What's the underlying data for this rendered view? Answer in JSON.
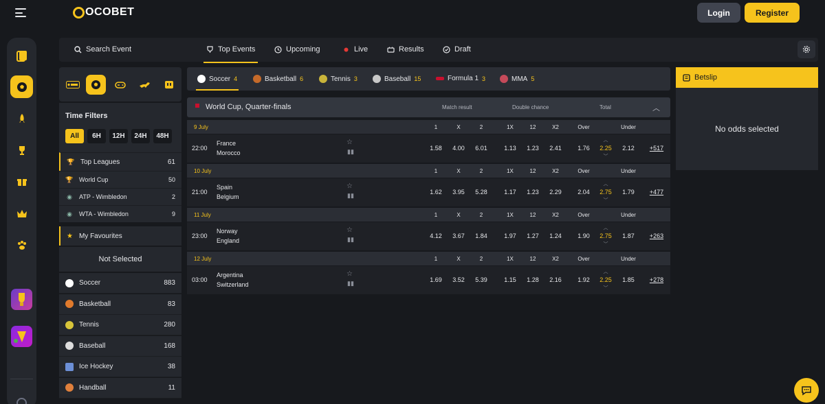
{
  "header": {
    "logo_text": "OCOBET",
    "login_label": "Login",
    "register_label": "Register"
  },
  "colors": {
    "accent": "#f6c31c",
    "background": "#17191d",
    "panel": "#25282e"
  },
  "rail": {
    "items": [
      {
        "icon": "casino-card-icon"
      },
      {
        "icon": "soccer-ball-icon",
        "active": true
      },
      {
        "icon": "rocket-icon"
      },
      {
        "icon": "trophy-icon"
      },
      {
        "icon": "gift-icon"
      },
      {
        "icon": "crown-icon"
      },
      {
        "icon": "paw-icon"
      }
    ]
  },
  "nav": {
    "search_label": "Search Event",
    "tabs": [
      {
        "label": "Top Events",
        "icon": "trophy-icon",
        "active": true
      },
      {
        "label": "Upcoming",
        "icon": "clock-icon"
      },
      {
        "label": "Live",
        "icon": "live-dot-icon"
      },
      {
        "label": "Results",
        "icon": "scoreboard-icon"
      },
      {
        "label": "Draft",
        "icon": "draft-icon"
      }
    ]
  },
  "sidebar": {
    "time_filters_title": "Time Filters",
    "time_filters": [
      "All",
      "6H",
      "12H",
      "24H",
      "48H"
    ],
    "top_leagues": {
      "label": "Top Leagues",
      "count": "61"
    },
    "leagues": [
      {
        "label": "World Cup",
        "count": "50"
      },
      {
        "label": "ATP - Wimbledon",
        "count": "2"
      },
      {
        "label": "WTA - Wimbledon",
        "count": "9"
      }
    ],
    "favourites_label": "My Favourites",
    "not_selected_label": "Not Selected",
    "sports": [
      {
        "label": "Soccer",
        "count": "883",
        "color": "#ffffff"
      },
      {
        "label": "Basketball",
        "count": "83",
        "color": "#e07a2c"
      },
      {
        "label": "Tennis",
        "count": "280",
        "color": "#d7c43a"
      },
      {
        "label": "Baseball",
        "count": "168",
        "color": "#dddddd"
      },
      {
        "label": "Ice Hockey",
        "count": "38",
        "color": "#6c8fd6"
      },
      {
        "label": "Handball",
        "count": "11",
        "color": "#e0803c"
      }
    ]
  },
  "sport_tabs": [
    {
      "label": "Soccer",
      "count": "4",
      "color": "#ffffff",
      "active": true
    },
    {
      "label": "Basketball",
      "count": "6",
      "color": "#c56a2a"
    },
    {
      "label": "Tennis",
      "count": "3",
      "color": "#c9b43a"
    },
    {
      "label": "Baseball",
      "count": "15",
      "color": "#c8c8c8"
    },
    {
      "label": "Formula 1",
      "count": "3",
      "color": "#c8102e"
    },
    {
      "label": "MMA",
      "count": "5",
      "color": "#c54a5a"
    }
  ],
  "competition": {
    "name": "World Cup, Quarter-finals",
    "col_match_result": "Match result",
    "col_double_chance": "Double chance",
    "col_total": "Total"
  },
  "odds_headers": [
    "1",
    "X",
    "2",
    "1X",
    "12",
    "X2",
    "Over",
    "Under"
  ],
  "days": [
    {
      "date": "9 July",
      "match": {
        "time": "22:00",
        "home": "France",
        "away": "Morocco",
        "odds": [
          "1.58",
          "4.00",
          "6.01",
          "1.13",
          "1.23",
          "2.41",
          "1.76",
          "2.25",
          "2.12"
        ],
        "more": "+517"
      }
    },
    {
      "date": "10 July",
      "match": {
        "time": "21:00",
        "home": "Spain",
        "away": "Belgium",
        "odds": [
          "1.62",
          "3.95",
          "5.28",
          "1.17",
          "1.23",
          "2.29",
          "2.04",
          "2.75",
          "1.79"
        ],
        "more": "+477"
      }
    },
    {
      "date": "11 July",
      "match": {
        "time": "23:00",
        "home": "Norway",
        "away": "England",
        "odds": [
          "4.12",
          "3.67",
          "1.84",
          "1.97",
          "1.27",
          "1.24",
          "1.90",
          "2.75",
          "1.87"
        ],
        "more": "+263"
      }
    },
    {
      "date": "12 July",
      "match": {
        "time": "03:00",
        "home": "Argentina",
        "away": "Switzerland",
        "odds": [
          "1.69",
          "3.52",
          "5.39",
          "1.15",
          "1.28",
          "2.16",
          "1.92",
          "2.25",
          "1.85"
        ],
        "more": "+278"
      }
    }
  ],
  "betslip": {
    "title": "Betslip",
    "empty_text": "No odds selected"
  }
}
